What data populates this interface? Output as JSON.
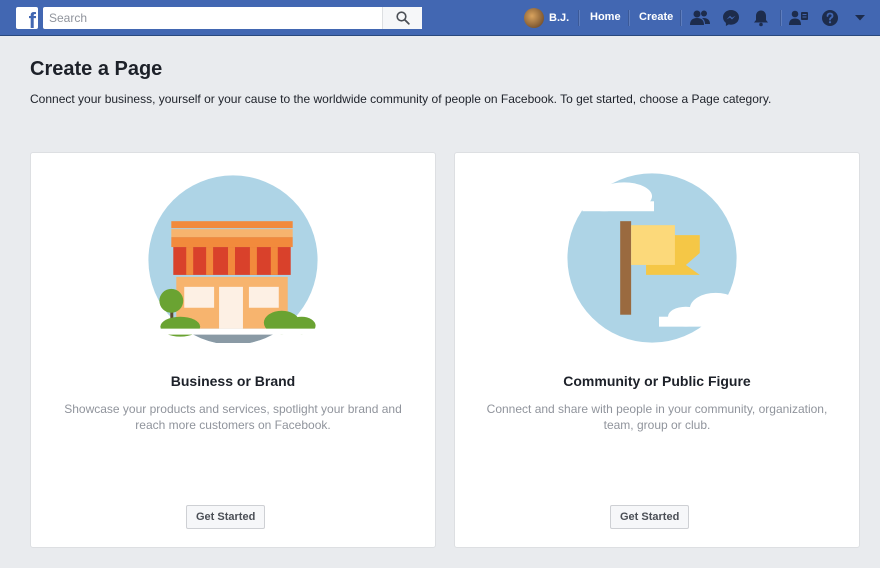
{
  "topbar": {
    "logo_letter": "f",
    "search_placeholder": "Search",
    "user_name": "B.J.",
    "home_label": "Home",
    "create_label": "Create",
    "colors": {
      "bar": "#4267b2",
      "bar_border": "#29487d"
    }
  },
  "header": {
    "title": "Create a Page",
    "subtitle": "Connect your business, yourself or your cause to the worldwide community of people on Facebook. To get started, choose a Page category."
  },
  "cards": [
    {
      "title": "Business or Brand",
      "description": "Showcase your products and services, spotlight your brand and reach more customers on Facebook.",
      "button_label": "Get Started",
      "icon": "storefront-illustration"
    },
    {
      "title": "Community or Public Figure",
      "description": "Connect and share with people in your community, organization, team, group or club.",
      "button_label": "Get Started",
      "icon": "flag-illustration"
    }
  ]
}
